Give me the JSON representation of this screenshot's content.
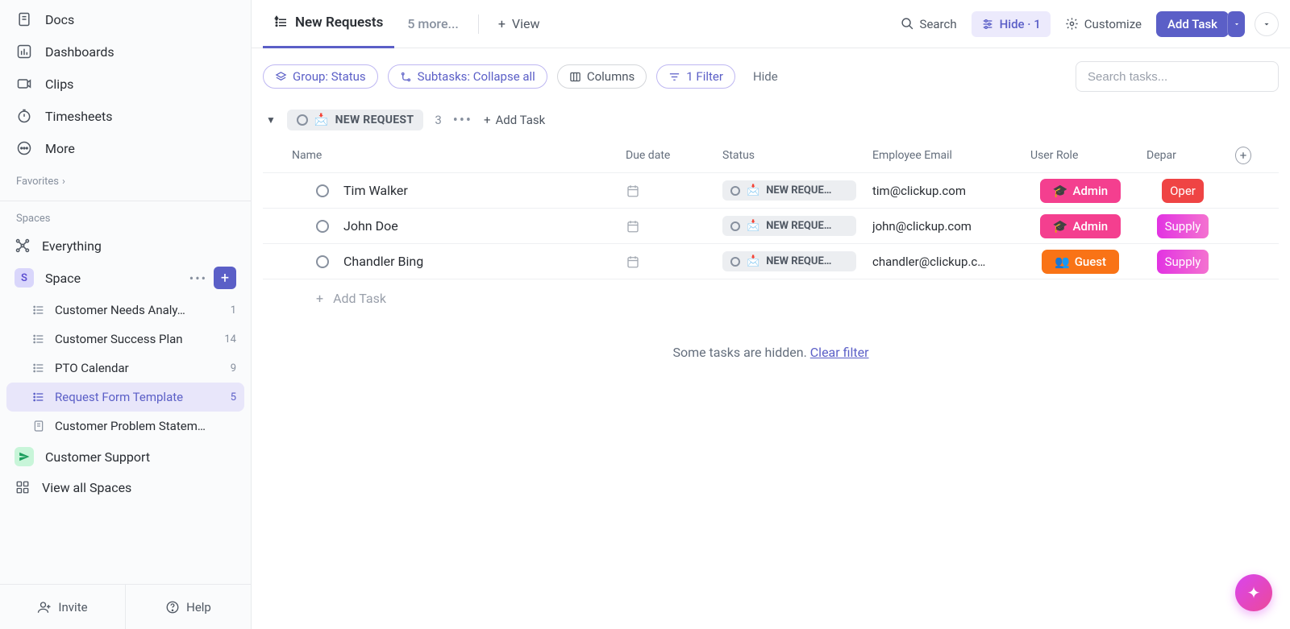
{
  "sidebar": {
    "nav": [
      {
        "label": "Docs",
        "icon": "doc"
      },
      {
        "label": "Dashboards",
        "icon": "dash"
      },
      {
        "label": "Clips",
        "icon": "clip"
      },
      {
        "label": "Timesheets",
        "icon": "timer"
      },
      {
        "label": "More",
        "icon": "more"
      }
    ],
    "favorites_label": "Favorites",
    "spaces_label": "Spaces",
    "everything_label": "Everything",
    "space": {
      "letter": "S",
      "name": "Space"
    },
    "lists": [
      {
        "name": "Customer Needs Analy…",
        "count": "1",
        "active": false,
        "icon": "list"
      },
      {
        "name": "Customer Success Plan",
        "count": "14",
        "active": false,
        "icon": "list"
      },
      {
        "name": "PTO Calendar",
        "count": "9",
        "active": false,
        "icon": "list"
      },
      {
        "name": "Request Form Template",
        "count": "5",
        "active": true,
        "icon": "list"
      },
      {
        "name": "Customer Problem Statem…",
        "count": "",
        "active": false,
        "icon": "doc"
      }
    ],
    "customer_support": "Customer Support",
    "view_all": "View all Spaces",
    "invite": "Invite",
    "help": "Help"
  },
  "tabs": {
    "active": "New Requests",
    "more": "5 more...",
    "view": "View"
  },
  "topright": {
    "search": "Search",
    "hide": "Hide · 1",
    "customize": "Customize",
    "add_task": "Add Task"
  },
  "toolbar": {
    "group": "Group: Status",
    "subtasks": "Subtasks: Collapse all",
    "columns": "Columns",
    "filter": "1 Filter",
    "hide": "Hide",
    "search_placeholder": "Search tasks..."
  },
  "group": {
    "name": "NEW REQUEST",
    "emoji": "📩",
    "count": "3",
    "add": "Add Task"
  },
  "columns": {
    "name": "Name",
    "due": "Due date",
    "status": "Status",
    "email": "Employee Email",
    "role": "User Role",
    "dept": "Depar"
  },
  "rows": [
    {
      "name": "Tim Walker",
      "status": "NEW REQUE…",
      "email": "tim@clickup.com",
      "role": "Admin",
      "role_emoji": "🎓",
      "role_class": "role-admin",
      "dept": "Oper",
      "dept_class": "dept-oper"
    },
    {
      "name": "John Doe",
      "status": "NEW REQUE…",
      "email": "john@clickup.com",
      "role": "Admin",
      "role_emoji": "🎓",
      "role_class": "role-admin",
      "dept": "Supply",
      "dept_class": "dept-supply"
    },
    {
      "name": "Chandler Bing",
      "status": "NEW REQUE…",
      "email": "chandler@clickup.c…",
      "role": "Guest",
      "role_emoji": "👥",
      "role_class": "role-guest",
      "dept": "Supply",
      "dept_class": "dept-supply"
    }
  ],
  "addrow": "Add Task",
  "hidden_msg": "Some tasks are hidden. ",
  "clear_filter": "Clear filter"
}
